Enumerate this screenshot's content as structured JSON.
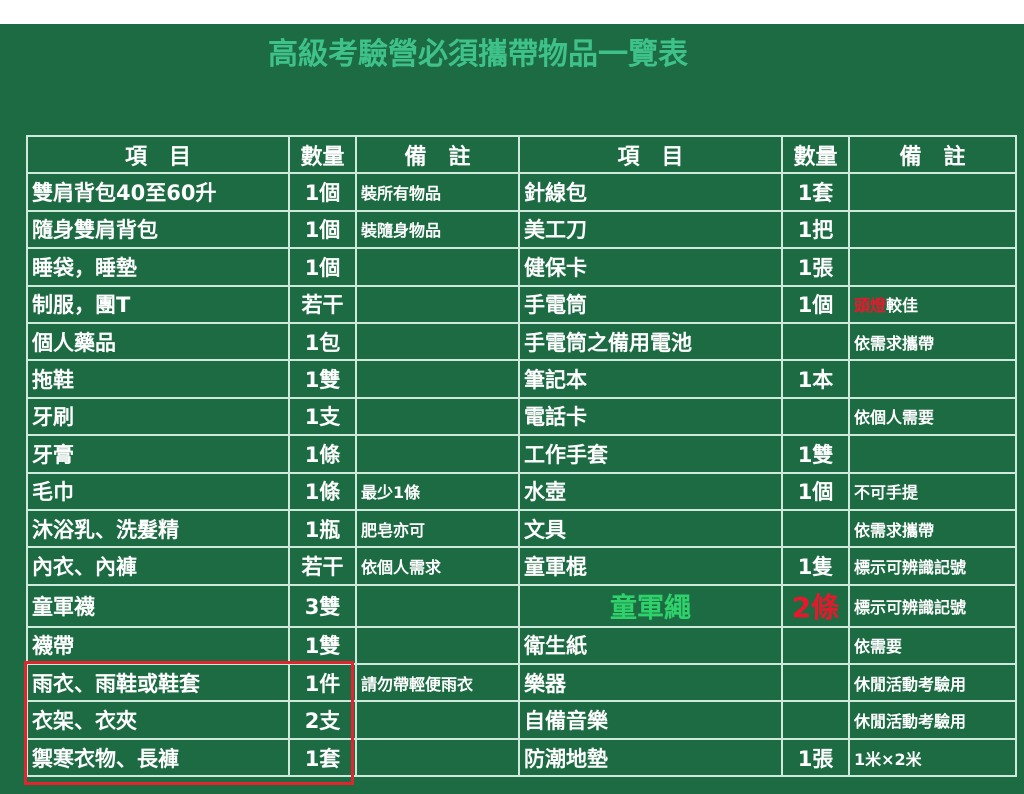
{
  "title": "高級考驗營必須攜帶物品一覽表",
  "headers": [
    "項　目",
    "數量",
    "備　註",
    "項　目",
    "數量",
    "備　註"
  ],
  "left_rows": [
    {
      "item": "雙肩背包40至60升",
      "qty": "1個",
      "note": "裝所有物品"
    },
    {
      "item": "隨身雙肩背包",
      "qty": "1個",
      "note": "裝隨身物品"
    },
    {
      "item": "睡袋，睡墊",
      "qty": "1個",
      "note": ""
    },
    {
      "item": "制服，團T",
      "qty": "若干",
      "note": ""
    },
    {
      "item": "個人藥品",
      "qty": "1包",
      "note": ""
    },
    {
      "item": "拖鞋",
      "qty": "1雙",
      "note": ""
    },
    {
      "item": "牙刷",
      "qty": "1支",
      "note": ""
    },
    {
      "item": "牙膏",
      "qty": "1條",
      "note": ""
    },
    {
      "item": "毛巾",
      "qty": "1條",
      "note": "最少1條"
    },
    {
      "item": "沐浴乳、洗髮精",
      "qty": "1瓶",
      "note": "肥皂亦可"
    },
    {
      "item": "內衣、內褲",
      "qty": "若干",
      "note": "依個人需求"
    },
    {
      "item": "童軍襪",
      "qty": "3雙",
      "note": ""
    },
    {
      "item": "襪帶",
      "qty": "1雙",
      "note": ""
    },
    {
      "item": "雨衣、雨鞋或鞋套",
      "qty": "1件",
      "note": "請勿帶輕便雨衣"
    },
    {
      "item": "衣架、衣夾",
      "qty": "2支",
      "note": ""
    },
    {
      "item": "禦寒衣物、長褲",
      "qty": "1套",
      "note": ""
    }
  ],
  "right_rows": [
    {
      "item": "針線包",
      "qty": "1套",
      "note": ""
    },
    {
      "item": "美工刀",
      "qty": "1把",
      "note": ""
    },
    {
      "item": "健保卡",
      "qty": "1張",
      "note": ""
    },
    {
      "item": "手電筒",
      "qty": "1個",
      "note_red": "頭燈",
      "note": "較佳"
    },
    {
      "item": "手電筒之備用電池",
      "qty": "",
      "note": "依需求攜帶"
    },
    {
      "item": "筆記本",
      "qty": "1本",
      "note": ""
    },
    {
      "item": "電話卡",
      "qty": "",
      "note": "依個人需要"
    },
    {
      "item": "工作手套",
      "qty": "1雙",
      "note": ""
    },
    {
      "item": "水壺",
      "qty": "1個",
      "note": "不可手提"
    },
    {
      "item": "文具",
      "qty": "",
      "note": "依需求攜帶"
    },
    {
      "item": "童軍棍",
      "qty": "1隻",
      "note": "標示可辨識記號"
    },
    {
      "item": "童軍繩",
      "qty": "2條",
      "note": "標示可辨識記號",
      "highlight": true
    },
    {
      "item": "衛生紙",
      "qty": "",
      "note": "依需要"
    },
    {
      "item": "樂器",
      "qty": "",
      "note": "休閒活動考驗用"
    },
    {
      "item": "自備音樂",
      "qty": "",
      "note": "休閒活動考驗用"
    },
    {
      "item": "防潮地墊",
      "qty": "1張",
      "note": "1米×2米"
    }
  ],
  "colors": {
    "background": "#1c6b43",
    "title": "#3fc18a",
    "border": "#cfe9dc",
    "emphasis_red": "#e8182c",
    "emphasis_green": "#2fd16a",
    "box": "#e1242d"
  }
}
